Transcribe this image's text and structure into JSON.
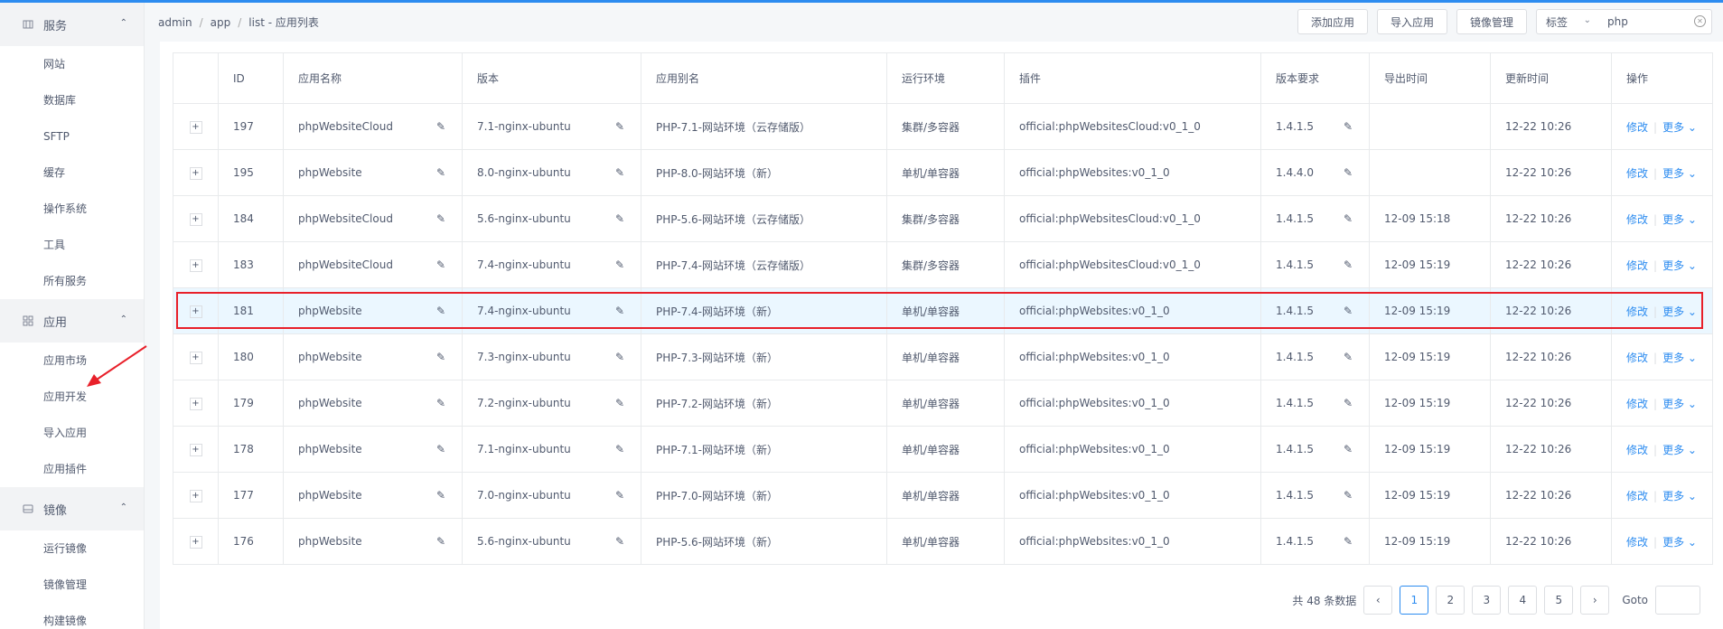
{
  "sidebar": {
    "sections": [
      {
        "title": "服务",
        "icon": "grid-icon",
        "items": [
          "网站",
          "数据库",
          "SFTP",
          "缓存",
          "操作系统",
          "工具",
          "所有服务"
        ]
      },
      {
        "title": "应用",
        "icon": "apps-icon",
        "items": [
          "应用市场",
          "应用开发",
          "导入应用",
          "应用插件"
        ]
      },
      {
        "title": "镜像",
        "icon": "disk-icon",
        "items": [
          "运行镜像",
          "镜像管理",
          "构建镜像"
        ]
      }
    ]
  },
  "breadcrumb": [
    "admin",
    "app",
    "list - 应用列表"
  ],
  "toolbar": {
    "add_app": "添加应用",
    "import_app": "导入应用",
    "image_manage": "镜像管理",
    "tag_label": "标签",
    "search_value": "php"
  },
  "table": {
    "headers": [
      "",
      "ID",
      "应用名称",
      "版本",
      "应用别名",
      "运行环境",
      "插件",
      "版本要求",
      "导出时间",
      "更新时间",
      "操作"
    ],
    "rows": [
      {
        "id": "197",
        "name": "phpWebsiteCloud",
        "version": "7.1-nginx-ubuntu",
        "alias": "PHP-7.1-网站环境（云存储版）",
        "env": "集群/多容器",
        "plugin": "official:phpWebsitesCloud:v0_1_0",
        "req": "1.4.1.5",
        "export": "",
        "update": "12-22 10:26"
      },
      {
        "id": "195",
        "name": "phpWebsite",
        "version": "8.0-nginx-ubuntu",
        "alias": "PHP-8.0-网站环境（新）",
        "env": "单机/单容器",
        "plugin": "official:phpWebsites:v0_1_0",
        "req": "1.4.4.0",
        "export": "",
        "update": "12-22 10:26"
      },
      {
        "id": "184",
        "name": "phpWebsiteCloud",
        "version": "5.6-nginx-ubuntu",
        "alias": "PHP-5.6-网站环境（云存储版）",
        "env": "集群/多容器",
        "plugin": "official:phpWebsitesCloud:v0_1_0",
        "req": "1.4.1.5",
        "export": "12-09 15:18",
        "update": "12-22 10:26"
      },
      {
        "id": "183",
        "name": "phpWebsiteCloud",
        "version": "7.4-nginx-ubuntu",
        "alias": "PHP-7.4-网站环境（云存储版）",
        "env": "集群/多容器",
        "plugin": "official:phpWebsitesCloud:v0_1_0",
        "req": "1.4.1.5",
        "export": "12-09 15:19",
        "update": "12-22 10:26"
      },
      {
        "id": "181",
        "name": "phpWebsite",
        "version": "7.4-nginx-ubuntu",
        "alias": "PHP-7.4-网站环境（新）",
        "env": "单机/单容器",
        "plugin": "official:phpWebsites:v0_1_0",
        "req": "1.4.1.5",
        "export": "12-09 15:19",
        "update": "12-22 10:26"
      },
      {
        "id": "180",
        "name": "phpWebsite",
        "version": "7.3-nginx-ubuntu",
        "alias": "PHP-7.3-网站环境（新）",
        "env": "单机/单容器",
        "plugin": "official:phpWebsites:v0_1_0",
        "req": "1.4.1.5",
        "export": "12-09 15:19",
        "update": "12-22 10:26"
      },
      {
        "id": "179",
        "name": "phpWebsite",
        "version": "7.2-nginx-ubuntu",
        "alias": "PHP-7.2-网站环境（新）",
        "env": "单机/单容器",
        "plugin": "official:phpWebsites:v0_1_0",
        "req": "1.4.1.5",
        "export": "12-09 15:19",
        "update": "12-22 10:26"
      },
      {
        "id": "178",
        "name": "phpWebsite",
        "version": "7.1-nginx-ubuntu",
        "alias": "PHP-7.1-网站环境（新）",
        "env": "单机/单容器",
        "plugin": "official:phpWebsites:v0_1_0",
        "req": "1.4.1.5",
        "export": "12-09 15:19",
        "update": "12-22 10:26"
      },
      {
        "id": "177",
        "name": "phpWebsite",
        "version": "7.0-nginx-ubuntu",
        "alias": "PHP-7.0-网站环境（新）",
        "env": "单机/单容器",
        "plugin": "official:phpWebsites:v0_1_0",
        "req": "1.4.1.5",
        "export": "12-09 15:19",
        "update": "12-22 10:26"
      },
      {
        "id": "176",
        "name": "phpWebsite",
        "version": "5.6-nginx-ubuntu",
        "alias": "PHP-5.6-网站环境（新）",
        "env": "单机/单容器",
        "plugin": "official:phpWebsites:v0_1_0",
        "req": "1.4.1.5",
        "export": "12-09 15:19",
        "update": "12-22 10:26"
      }
    ],
    "edit_label": "修改",
    "more_label": "更多"
  },
  "pager": {
    "total": "共 48 条数据",
    "pages": [
      "1",
      "2",
      "3",
      "4",
      "5"
    ],
    "goto_label": "Goto"
  },
  "colors": {
    "accent": "#2d8cf0",
    "highlight_border": "#e8202a",
    "selected_row": "#ebf7ff"
  }
}
